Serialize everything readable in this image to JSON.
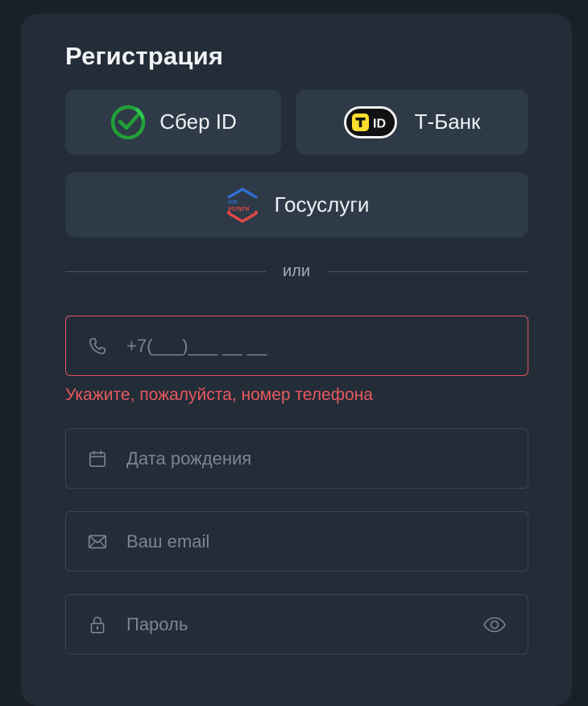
{
  "title": "Регистрация",
  "oauth": {
    "sber_label": "Сбер ID",
    "tbank_label": "Т-Банк",
    "tbank_badge": "ID",
    "gos_label": "Госуслуги",
    "gos_logo_top": "гос",
    "gos_logo_bottom": "услуги"
  },
  "divider": "или",
  "fields": {
    "phone_placeholder": "+7(___)___ __ __",
    "phone_error": "Укажите, пожалуйста, номер телефона",
    "birthdate_placeholder": "Дата рождения",
    "email_placeholder": "Ваш email",
    "password_placeholder": "Пароль"
  },
  "colors": {
    "card_bg": "#232d38",
    "button_bg": "#2e3a47",
    "error": "#e05560",
    "sber_green": "#21a038",
    "tbank_yellow": "#ffdd2d"
  },
  "icons": {
    "phone": "phone-icon",
    "calendar": "calendar-icon",
    "mail": "mail-icon",
    "lock": "lock-icon",
    "eye": "eye-icon"
  }
}
